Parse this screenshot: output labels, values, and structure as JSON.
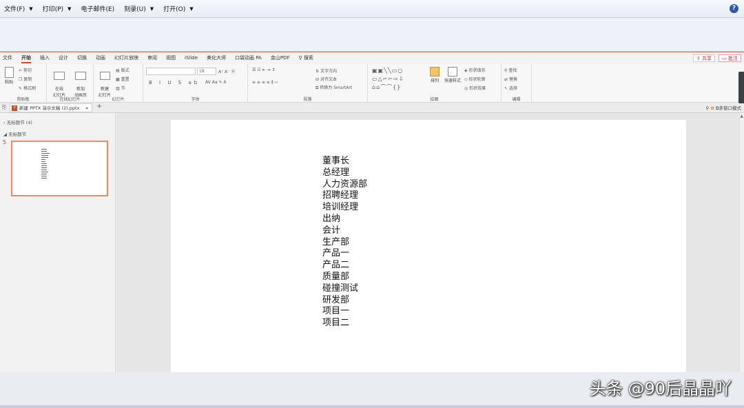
{
  "outer_menu": [
    {
      "label": "文件(F)",
      "has_caret": true
    },
    {
      "label": "打印(P)",
      "has_caret": true
    },
    {
      "label": "电子邮件(E)",
      "has_caret": false
    },
    {
      "label": "刻录(U)",
      "has_caret": true
    },
    {
      "label": "打开(O)",
      "has_caret": true
    }
  ],
  "ribbon_tabs": [
    "文件",
    "开始",
    "插入",
    "设计",
    "切换",
    "动画",
    "幻灯片放映",
    "审阅",
    "视图",
    "iSlide",
    "美化大师",
    "口袋动画 PA",
    "金山PDF",
    "搜索"
  ],
  "active_tab": "开始",
  "share_label": "共享",
  "comment_label": "批注",
  "ribbon": {
    "clipboard": {
      "label": "剪贴板",
      "paste": "粘贴",
      "cut": "剪切",
      "copy": "复制",
      "format_painter": "格式刷"
    },
    "online_slides": {
      "label": "在线幻灯片",
      "online": "在线\n幻灯片",
      "new_anim": "新加\n动画页"
    },
    "slides": {
      "label": "幻灯片",
      "new_slide": "新建\n幻灯片",
      "layout": "版式",
      "reset": "重置",
      "section": "节"
    },
    "font": {
      "label": "字体",
      "size": "18",
      "format_bar": "B I U S ab"
    },
    "paragraph": {
      "label": "段落",
      "text_direction": "文字方向",
      "align_text": "对齐文本",
      "smartart": "转换为 SmartArt"
    },
    "drawing": {
      "label": "绘图",
      "arrange": "排列",
      "quick_styles": "快速样式",
      "fill": "形状填充",
      "outline": "形状轮廓",
      "effects": "形状效果"
    },
    "editing": {
      "label": "编辑",
      "find": "查找",
      "replace": "替换",
      "select": "选择"
    }
  },
  "document_tab": "新建 PPTX 演示文稿 (2).pptx",
  "multi_window": "多窗口模式",
  "sections": [
    "无标题节 (4)",
    "无标题节"
  ],
  "slide_number": "5",
  "slide_lines": [
    "董事长",
    "总经理",
    "人力资源部",
    "招聘经理",
    "培训经理",
    "出纳",
    "会计",
    "生产部",
    "产品一",
    "产品二",
    "质量部",
    "碰撞测试",
    "研发部",
    "项目一",
    "项目二"
  ],
  "watermark": "头条 @90后晶晶吖"
}
